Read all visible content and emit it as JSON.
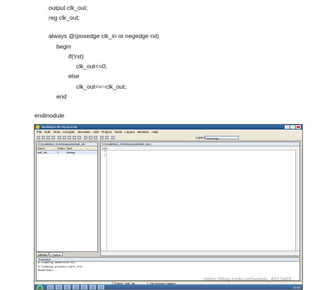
{
  "code": {
    "lines": [
      "output clk_out;",
      "reg clk_out;",
      "always @(posedge clk_in or negedge rst)",
      "begin",
      "if(!rst)",
      "clk_out<=0;",
      "else",
      "clk_out<=~clk_out;",
      "end",
      "endmodule"
    ]
  },
  "window": {
    "title": "ModelSim SE PLUS 6.5d",
    "menu": [
      "File",
      "Edit",
      "View",
      "Compile",
      "Simulate",
      "Add",
      "Project",
      "Tools",
      "Layout",
      "Window",
      "Help"
    ],
    "layout_label": "Layout",
    "layout_value": "NoDesign"
  },
  "project_pane": {
    "title": "C:/modeltech_6.5d/examples/half_clk",
    "columns": [
      "Name",
      "Status",
      "Type"
    ],
    "files": [
      {
        "name": "half_clk",
        "status": "?",
        "type": "Verilog"
      }
    ],
    "tabs": [
      "Library",
      "Project"
    ]
  },
  "editor": {
    "path": "C:/modeltech_6.5d/examples/half_clk.v",
    "ln_header": "Ln#",
    "line_numbers": [
      "1",
      "2"
    ]
  },
  "transcript": {
    "title": "Transcript",
    "lines": [
      "# reading modelsim.ini",
      "# Loading project half_clk",
      "ModelSim>"
    ]
  },
  "status": {
    "project": "Project : half_clk",
    "design": "<No Design Loaded>"
  },
  "taskbar": {
    "clock": "20:33"
  },
  "watermark": "https://blog.csdn.net/weixin_4212469"
}
